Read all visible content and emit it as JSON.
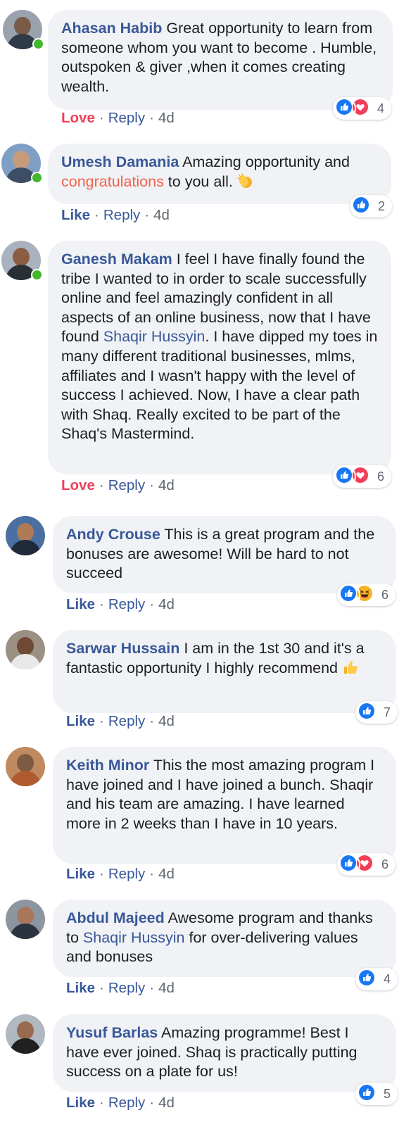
{
  "comments": [
    {
      "name": "Ahasan Habib",
      "parts": [
        {
          "t": "text",
          "v": "Great opportunity to learn from someone whom you want to become . Humble, outspoken & giver ,when it comes creating wealth."
        }
      ],
      "action": "Love",
      "reply": "Reply",
      "time": "4d",
      "reactions": [
        "like",
        "love"
      ],
      "count": "4",
      "online": true
    },
    {
      "name": "Umesh Damania",
      "parts": [
        {
          "t": "text",
          "v": "Amazing opportunity and "
        },
        {
          "t": "link-orange",
          "v": "congratulations"
        },
        {
          "t": "text",
          "v": " to you all."
        },
        {
          "t": "emoji",
          "v": "clap-emoji"
        }
      ],
      "action": "Like",
      "reply": "Reply",
      "time": "4d",
      "reactions": [
        "like"
      ],
      "count": "2",
      "online": true
    },
    {
      "name": "Ganesh Makam",
      "parts": [
        {
          "t": "text",
          "v": "I feel I have finally found the tribe I wanted to in order to scale successfully online and feel amazingly confident in all aspects of an online business, now that I have found "
        },
        {
          "t": "link",
          "v": "Shaqir Hussyin"
        },
        {
          "t": "text",
          "v": ". I have dipped my toes in many different traditional businesses, mlms, affiliates and I wasn't happy with the level of success I achieved. Now, I have a clear path with Shaq. Really excited to be part of the Shaq's Mastermind."
        }
      ],
      "action": "Love",
      "reply": "Reply",
      "time": "4d",
      "reactions": [
        "like",
        "love"
      ],
      "count": "6",
      "online": true
    },
    {
      "name": "Andy Crouse",
      "parts": [
        {
          "t": "text",
          "v": "This is a great program and the bonuses are awesome! Will be hard to not succeed"
        }
      ],
      "action": "Like",
      "reply": "Reply",
      "time": "4d",
      "reactions": [
        "like",
        "haha"
      ],
      "count": "6",
      "online": false
    },
    {
      "name": "Sarwar Hussain",
      "parts": [
        {
          "t": "text",
          "v": "I am in the 1st 30 and it's a fantastic opportunity I highly recommend"
        },
        {
          "t": "emoji",
          "v": "thumbs-up-emoji"
        }
      ],
      "action": "Like",
      "reply": "Reply",
      "time": "4d",
      "reactions": [
        "like"
      ],
      "count": "7",
      "online": false
    },
    {
      "name": "Keith Minor",
      "parts": [
        {
          "t": "text",
          "v": "This the most amazing program I have joined and I have joined a bunch. Shaqir and his team are amazing. I have learned more in 2 weeks than I have in 10 years."
        }
      ],
      "action": "Like",
      "reply": "Reply",
      "time": "4d",
      "reactions": [
        "like",
        "love"
      ],
      "count": "6",
      "online": false
    },
    {
      "name": "Abdul Majeed",
      "parts": [
        {
          "t": "text",
          "v": "Awesome program and thanks to "
        },
        {
          "t": "link",
          "v": "Shaqir Hussyin"
        },
        {
          "t": "text",
          "v": " for over-delivering values and bonuses"
        }
      ],
      "action": "Like",
      "reply": "Reply",
      "time": "4d",
      "reactions": [
        "like"
      ],
      "count": "4",
      "online": false
    },
    {
      "name": "Yusuf Barlas",
      "parts": [
        {
          "t": "text",
          "v": "Amazing programme! Best I have ever joined. Shaq is practically putting success on a plate for us!"
        }
      ],
      "action": "Like",
      "reply": "Reply",
      "time": "4d",
      "reactions": [
        "like"
      ],
      "count": "5",
      "online": false
    }
  ],
  "colors": {
    "link": "#385898",
    "love": "#f33e58",
    "like": "#1877f2",
    "online": "#42b72a",
    "bubble": "#f0f2f5"
  }
}
